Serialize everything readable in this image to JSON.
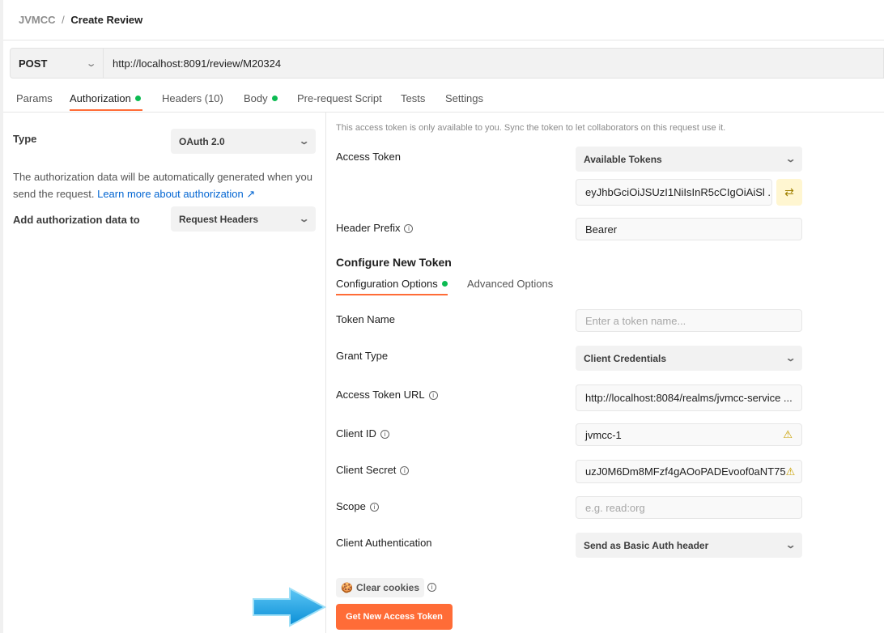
{
  "breadcrumb": {
    "workspace": "JVMCC",
    "separator": "/",
    "request": "Create Review"
  },
  "request": {
    "method": "POST",
    "url": "http://localhost:8091/review/M20324"
  },
  "tabs": [
    {
      "label": "Params"
    },
    {
      "label": "Authorization",
      "dot": true,
      "active": true
    },
    {
      "label": "Headers (10)"
    },
    {
      "label": "Body",
      "dot": true
    },
    {
      "label": "Pre-request Script"
    },
    {
      "label": "Tests"
    },
    {
      "label": "Settings"
    }
  ],
  "left": {
    "type_label": "Type",
    "type_value": "OAuth 2.0",
    "description": "The authorization data will be automatically generated when you send the request.",
    "learn_more": "Learn more about authorization ↗",
    "add_to_label": "Add authorization data to",
    "add_to_value": "Request Headers"
  },
  "right": {
    "notice": "This access token is only available to you. Sync the token to let collaborators on this request use it.",
    "access_token_label": "Access Token",
    "available_tokens": "Available Tokens",
    "token_value": "eyJhbGciOiJSUzI1NiIsInR5cCIgOiAiSl ...",
    "header_prefix_label": "Header Prefix",
    "header_prefix_value": "Bearer",
    "configure_title": "Configure New Token",
    "config_tab": "Configuration Options",
    "advanced_tab": "Advanced Options",
    "token_name_label": "Token Name",
    "token_name_placeholder": "Enter a token name...",
    "grant_type_label": "Grant Type",
    "grant_type_value": "Client Credentials",
    "access_token_url_label": "Access Token URL",
    "access_token_url_value": "http://localhost:8084/realms/jvmcc-service ...",
    "client_id_label": "Client ID",
    "client_id_value": "jvmcc-1",
    "client_secret_label": "Client Secret",
    "client_secret_value": "uzJ0M6Dm8MFzf4gAOoPADEvoof0aNT75",
    "scope_label": "Scope",
    "scope_placeholder": "e.g. read:org",
    "client_auth_label": "Client Authentication",
    "client_auth_value": "Send as Basic Auth header",
    "clear_cookies": "Clear cookies",
    "get_token": "Get New Access Token"
  },
  "colors": {
    "accent": "#ff6c37",
    "active_dot": "#0cbb52",
    "arrow": "#1ea5e6"
  }
}
